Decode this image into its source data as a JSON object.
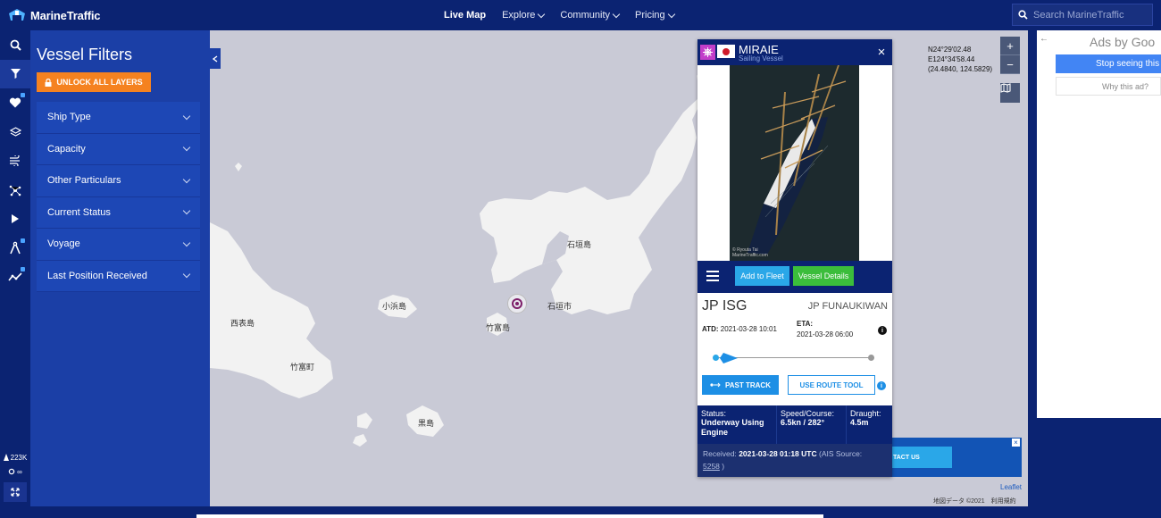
{
  "app": {
    "name": "MarineTraffic"
  },
  "nav": {
    "items": [
      {
        "label": "Live Map",
        "active": true,
        "dropdown": false
      },
      {
        "label": "Explore",
        "active": false,
        "dropdown": true
      },
      {
        "label": "Community",
        "active": false,
        "dropdown": true
      },
      {
        "label": "Pricing",
        "active": false,
        "dropdown": true
      }
    ]
  },
  "search": {
    "placeholder": "Search MarineTraffic"
  },
  "rail": {
    "icons": [
      "search-icon",
      "filter-icon",
      "heart-icon",
      "layers-icon",
      "wind-icon",
      "satellite-icon",
      "play-icon",
      "compass-icon",
      "chart-icon"
    ],
    "active": "filter-icon",
    "vessel_count": "223K",
    "extra": "∞"
  },
  "filters": {
    "title": "Vessel Filters",
    "unlock_label": "UNLOCK ALL LAYERS",
    "items": [
      {
        "label": "Ship Type"
      },
      {
        "label": "Capacity"
      },
      {
        "label": "Other Particulars"
      },
      {
        "label": "Current Status"
      },
      {
        "label": "Voyage"
      },
      {
        "label": "Last Position Received"
      }
    ]
  },
  "map": {
    "coords": {
      "lat": "N24°29'02.48",
      "lon": "E124°34'58.44",
      "decimal": "(24.4840, 124.5829)"
    },
    "labels": {
      "ishigaki_island": "石垣島",
      "ishigaki_city": "石垣市",
      "kohama": "小浜島",
      "taketomi_island": "竹富島",
      "taketomi_town": "竹富町",
      "iriomote": "西表島",
      "kuroshima": "黒島"
    },
    "zoom_in": "+",
    "zoom_out": "−",
    "attribution_leaflet": "Leaflet",
    "attribution_map": "地図データ ©2021　利用規約"
  },
  "vessel": {
    "name": "MIRAIE",
    "type": "Sailing Vessel",
    "photo_credit": "© Ryouta Tai\nMarineTraffic.com",
    "add_to_fleet": "Add to Fleet",
    "details": "Vessel Details",
    "from_port": "JP ISG",
    "to_port": "JP FUNAUKIWAN",
    "atd_label": "ATD:",
    "atd_value": "2021-03-28 10:01",
    "eta_label": "ETA:",
    "eta_value": "2021-03-28 06:00",
    "past_track": "PAST TRACK",
    "route_tool": "USE ROUTE TOOL",
    "status_label": "Status:",
    "status_value": "Underway Using Engine",
    "speed_label": "Speed/Course:",
    "speed_value": "6.5kn / 282°",
    "draught_label": "Draught:",
    "draught_value": "4.5m",
    "received_prefix": "Received:",
    "received_value": "2021-03-28 01:18 UTC",
    "ais_prefix": "(AIS Source:",
    "ais_value": "5258",
    "ais_suffix": ")",
    "progress": 0.05
  },
  "banner": {
    "button_label": "TACT US"
  },
  "ad": {
    "title": "Ads by Goo",
    "stop": "Stop seeing this",
    "why": "Why this ad?"
  },
  "colors": {
    "brand": "#0b2372",
    "panel": "#1b3fa6",
    "unlock": "#f58220",
    "fleet": "#2aa7e8",
    "details": "#3bbd3b",
    "map_sea": "#c9cad6"
  }
}
